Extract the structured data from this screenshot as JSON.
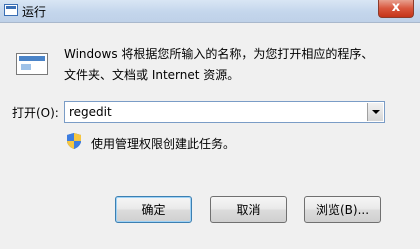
{
  "window": {
    "title": "运行",
    "close_label": "x"
  },
  "dialog": {
    "description_line1": "Windows 将根据您所输入的名称，为您打开相应的程序、",
    "description_line2": "文件夹、文档或 Internet 资源。",
    "open_label": "打开(O):",
    "open_value": "regedit",
    "admin_note": "使用管理权限创建此任务。"
  },
  "buttons": {
    "ok": "确定",
    "cancel": "取消",
    "browse": "浏览(B)..."
  },
  "icons": {
    "title": "run-icon",
    "program": "program-window-icon",
    "shield": "uac-shield-icon",
    "dropdown": "chevron-down-icon"
  },
  "colors": {
    "title_bar": "#c4d6ec",
    "close_button": "#d8563d",
    "default_button_border": "#3c7fb1"
  }
}
